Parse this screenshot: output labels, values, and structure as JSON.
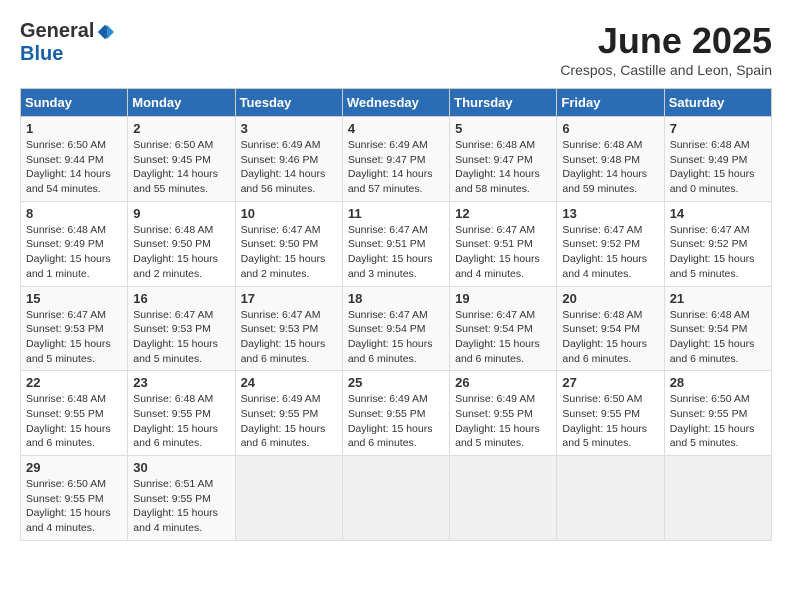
{
  "logo": {
    "general": "General",
    "blue": "Blue"
  },
  "title": "June 2025",
  "subtitle": "Crespos, Castille and Leon, Spain",
  "days_header": [
    "Sunday",
    "Monday",
    "Tuesday",
    "Wednesday",
    "Thursday",
    "Friday",
    "Saturday"
  ],
  "weeks": [
    [
      {
        "day": "1",
        "rise": "6:50 AM",
        "set": "9:44 PM",
        "hours": "14",
        "mins": "54"
      },
      {
        "day": "2",
        "rise": "6:50 AM",
        "set": "9:45 PM",
        "hours": "14",
        "mins": "55"
      },
      {
        "day": "3",
        "rise": "6:49 AM",
        "set": "9:46 PM",
        "hours": "14",
        "mins": "56"
      },
      {
        "day": "4",
        "rise": "6:49 AM",
        "set": "9:47 PM",
        "hours": "14",
        "mins": "57"
      },
      {
        "day": "5",
        "rise": "6:48 AM",
        "set": "9:47 PM",
        "hours": "14",
        "mins": "58"
      },
      {
        "day": "6",
        "rise": "6:48 AM",
        "set": "9:48 PM",
        "hours": "14",
        "mins": "59"
      },
      {
        "day": "7",
        "rise": "6:48 AM",
        "set": "9:49 PM",
        "hours": "15",
        "mins": "0"
      }
    ],
    [
      {
        "day": "8",
        "rise": "6:48 AM",
        "set": "9:49 PM",
        "hours": "15",
        "mins": "1"
      },
      {
        "day": "9",
        "rise": "6:48 AM",
        "set": "9:50 PM",
        "hours": "15",
        "mins": "2"
      },
      {
        "day": "10",
        "rise": "6:47 AM",
        "set": "9:50 PM",
        "hours": "15",
        "mins": "2"
      },
      {
        "day": "11",
        "rise": "6:47 AM",
        "set": "9:51 PM",
        "hours": "15",
        "mins": "3"
      },
      {
        "day": "12",
        "rise": "6:47 AM",
        "set": "9:51 PM",
        "hours": "15",
        "mins": "4"
      },
      {
        "day": "13",
        "rise": "6:47 AM",
        "set": "9:52 PM",
        "hours": "15",
        "mins": "4"
      },
      {
        "day": "14",
        "rise": "6:47 AM",
        "set": "9:52 PM",
        "hours": "15",
        "mins": "5"
      }
    ],
    [
      {
        "day": "15",
        "rise": "6:47 AM",
        "set": "9:53 PM",
        "hours": "15",
        "mins": "5"
      },
      {
        "day": "16",
        "rise": "6:47 AM",
        "set": "9:53 PM",
        "hours": "15",
        "mins": "5"
      },
      {
        "day": "17",
        "rise": "6:47 AM",
        "set": "9:53 PM",
        "hours": "15",
        "mins": "6"
      },
      {
        "day": "18",
        "rise": "6:47 AM",
        "set": "9:54 PM",
        "hours": "15",
        "mins": "6"
      },
      {
        "day": "19",
        "rise": "6:47 AM",
        "set": "9:54 PM",
        "hours": "15",
        "mins": "6"
      },
      {
        "day": "20",
        "rise": "6:48 AM",
        "set": "9:54 PM",
        "hours": "15",
        "mins": "6"
      },
      {
        "day": "21",
        "rise": "6:48 AM",
        "set": "9:54 PM",
        "hours": "15",
        "mins": "6"
      }
    ],
    [
      {
        "day": "22",
        "rise": "6:48 AM",
        "set": "9:55 PM",
        "hours": "15",
        "mins": "6"
      },
      {
        "day": "23",
        "rise": "6:48 AM",
        "set": "9:55 PM",
        "hours": "15",
        "mins": "6"
      },
      {
        "day": "24",
        "rise": "6:49 AM",
        "set": "9:55 PM",
        "hours": "15",
        "mins": "6"
      },
      {
        "day": "25",
        "rise": "6:49 AM",
        "set": "9:55 PM",
        "hours": "15",
        "mins": "6"
      },
      {
        "day": "26",
        "rise": "6:49 AM",
        "set": "9:55 PM",
        "hours": "15",
        "mins": "5"
      },
      {
        "day": "27",
        "rise": "6:50 AM",
        "set": "9:55 PM",
        "hours": "15",
        "mins": "5"
      },
      {
        "day": "28",
        "rise": "6:50 AM",
        "set": "9:55 PM",
        "hours": "15",
        "mins": "5"
      }
    ],
    [
      {
        "day": "29",
        "rise": "6:50 AM",
        "set": "9:55 PM",
        "hours": "15",
        "mins": "4"
      },
      {
        "day": "30",
        "rise": "6:51 AM",
        "set": "9:55 PM",
        "hours": "15",
        "mins": "4"
      },
      null,
      null,
      null,
      null,
      null
    ]
  ]
}
